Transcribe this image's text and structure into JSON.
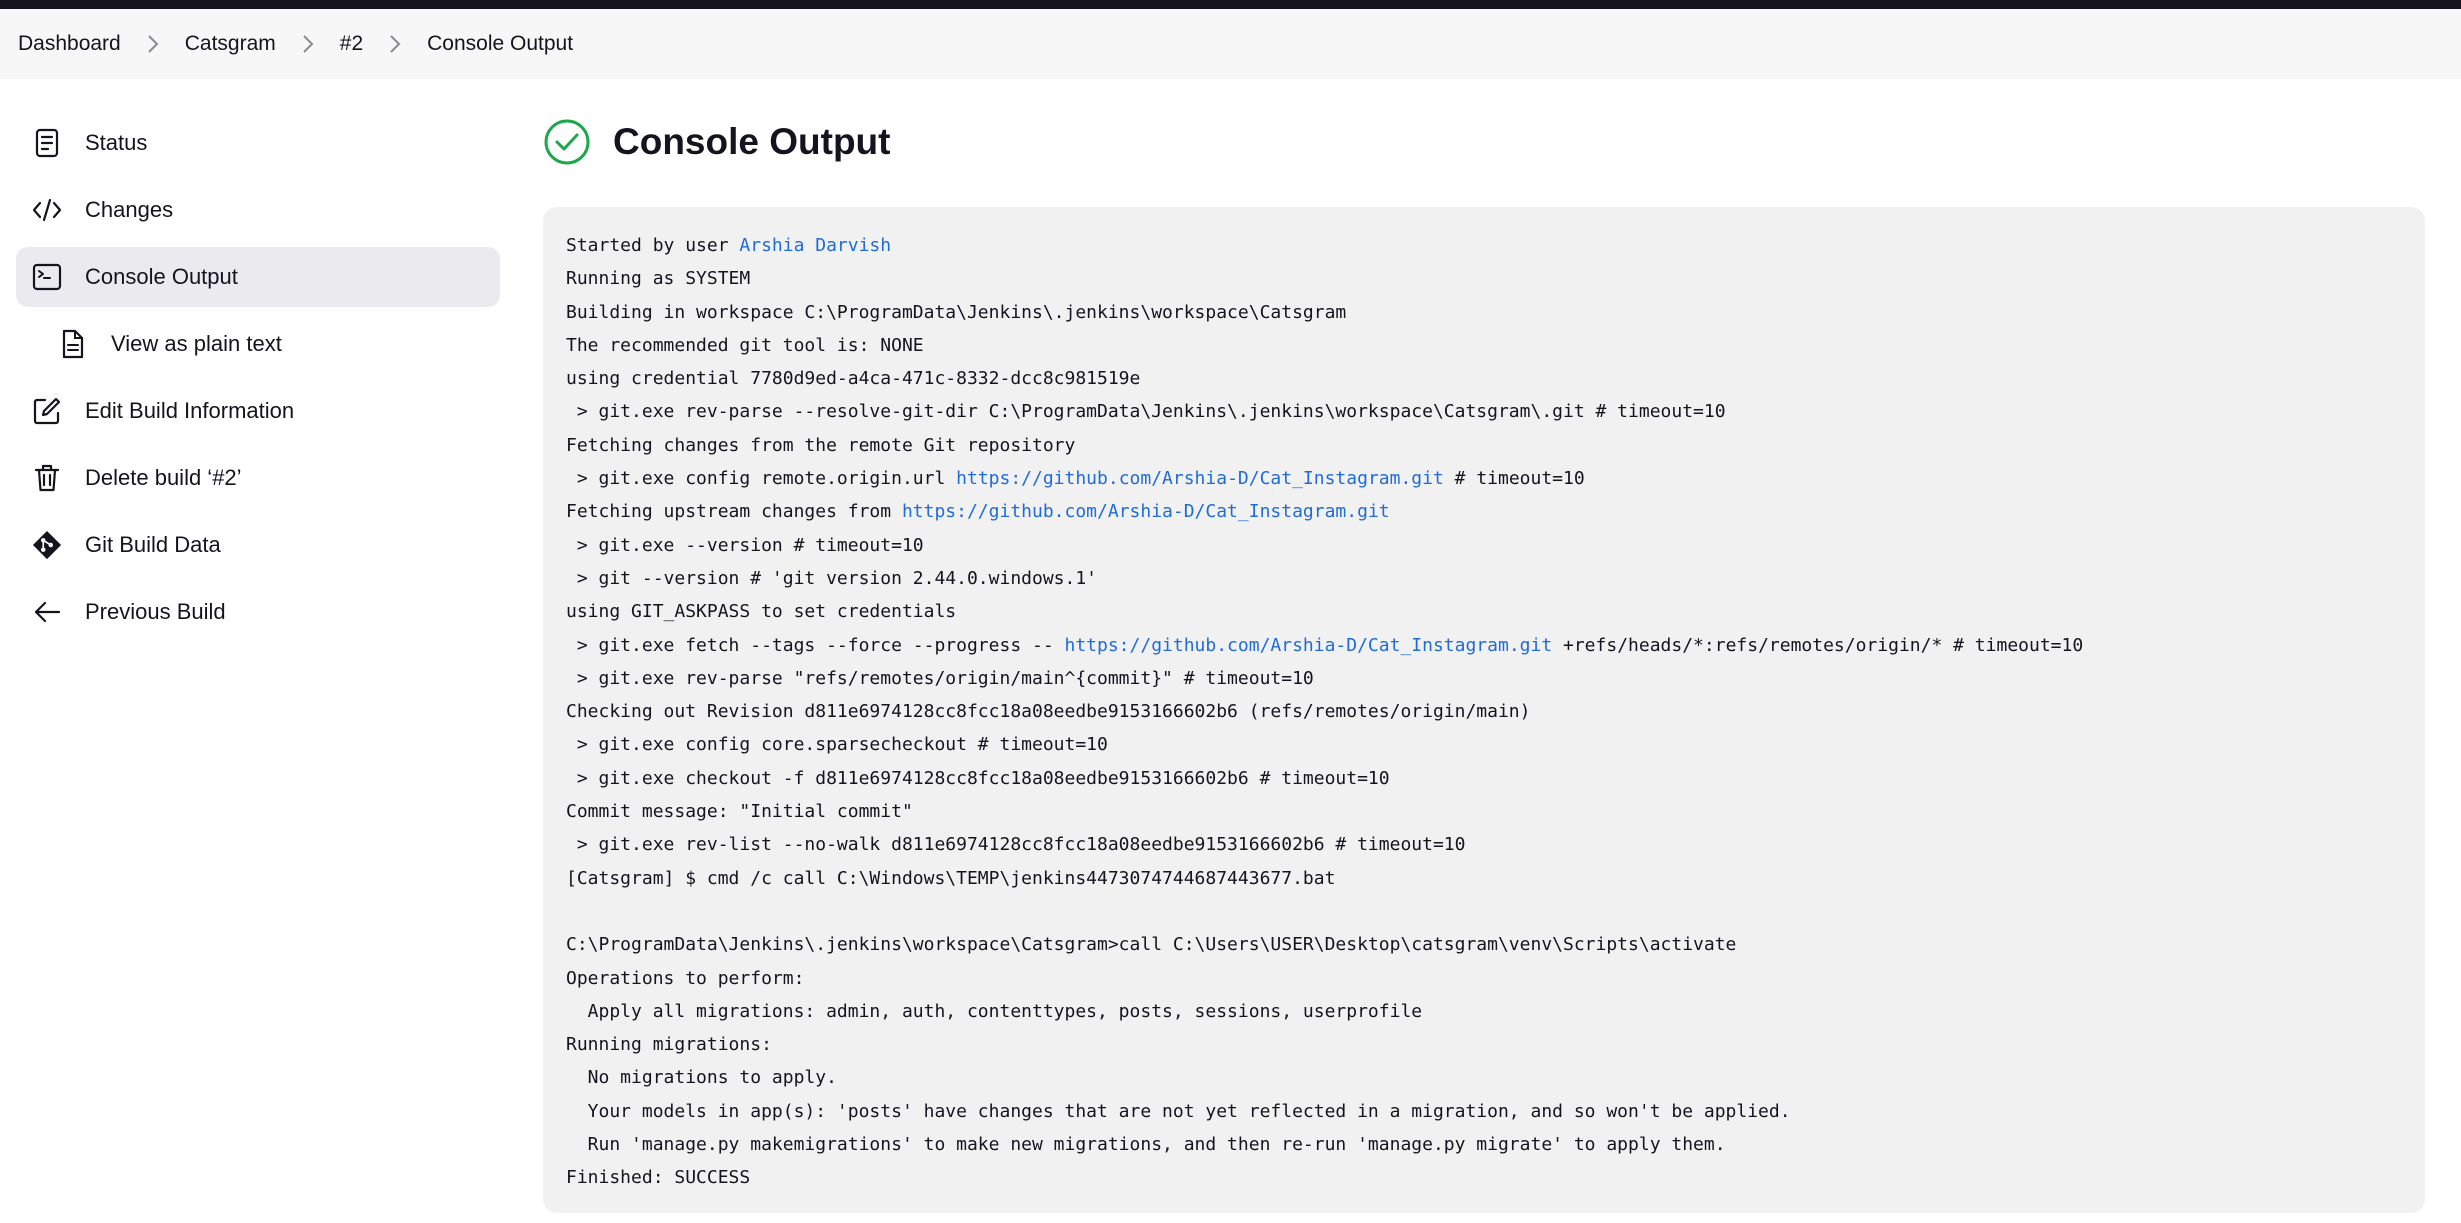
{
  "breadcrumb": [
    {
      "label": "Dashboard"
    },
    {
      "label": "Catsgram"
    },
    {
      "label": "#2"
    },
    {
      "label": "Console Output"
    }
  ],
  "sidebar": {
    "items": [
      {
        "label": "Status",
        "icon": "status-icon"
      },
      {
        "label": "Changes",
        "icon": "code-icon"
      },
      {
        "label": "Console Output",
        "icon": "terminal-icon",
        "active": true
      },
      {
        "label": "View as plain text",
        "icon": "document-icon"
      },
      {
        "label": "Edit Build Information",
        "icon": "edit-icon"
      },
      {
        "label": "Delete build ‘#2’",
        "icon": "trash-icon"
      },
      {
        "label": "Git Build Data",
        "icon": "git-icon"
      },
      {
        "label": "Previous Build",
        "icon": "arrow-left-icon"
      }
    ]
  },
  "main": {
    "title": "Console Output",
    "status_icon": "success-check-icon",
    "status_color": "#1ea64b"
  },
  "console": {
    "link_color": "#1f6bd8",
    "lines": [
      {
        "pre": "Started by user ",
        "link": "Arshia Darvish",
        "post": ""
      },
      {
        "text": "Running as SYSTEM"
      },
      {
        "text": "Building in workspace C:\\ProgramData\\Jenkins\\.jenkins\\workspace\\Catsgram"
      },
      {
        "text": "The recommended git tool is: NONE"
      },
      {
        "text": "using credential 7780d9ed-a4ca-471c-8332-dcc8c981519e"
      },
      {
        "text": " > git.exe rev-parse --resolve-git-dir C:\\ProgramData\\Jenkins\\.jenkins\\workspace\\Catsgram\\.git # timeout=10"
      },
      {
        "text": "Fetching changes from the remote Git repository"
      },
      {
        "pre": " > git.exe config remote.origin.url ",
        "link": "https://github.com/Arshia-D/Cat_Instagram.git",
        "post": " # timeout=10"
      },
      {
        "pre": "Fetching upstream changes from ",
        "link": "https://github.com/Arshia-D/Cat_Instagram.git",
        "post": ""
      },
      {
        "text": " > git.exe --version # timeout=10"
      },
      {
        "text": " > git --version # 'git version 2.44.0.windows.1'"
      },
      {
        "text": "using GIT_ASKPASS to set credentials"
      },
      {
        "pre": " > git.exe fetch --tags --force --progress -- ",
        "link": "https://github.com/Arshia-D/Cat_Instagram.git",
        "post": " +refs/heads/*:refs/remotes/origin/* # timeout=10"
      },
      {
        "text": " > git.exe rev-parse \"refs/remotes/origin/main^{commit}\" # timeout=10"
      },
      {
        "text": "Checking out Revision d811e6974128cc8fcc18a08eedbe9153166602b6 (refs/remotes/origin/main)"
      },
      {
        "text": " > git.exe config core.sparsecheckout # timeout=10"
      },
      {
        "text": " > git.exe checkout -f d811e6974128cc8fcc18a08eedbe9153166602b6 # timeout=10"
      },
      {
        "text": "Commit message: \"Initial commit\""
      },
      {
        "text": " > git.exe rev-list --no-walk d811e6974128cc8fcc18a08eedbe9153166602b6 # timeout=10"
      },
      {
        "text": "[Catsgram] $ cmd /c call C:\\Windows\\TEMP\\jenkins4473074744687443677.bat"
      },
      {
        "text": ""
      },
      {
        "text": "C:\\ProgramData\\Jenkins\\.jenkins\\workspace\\Catsgram>call C:\\Users\\USER\\Desktop\\catsgram\\venv\\Scripts\\activate"
      },
      {
        "text": "Operations to perform:"
      },
      {
        "text": "  Apply all migrations: admin, auth, contenttypes, posts, sessions, userprofile"
      },
      {
        "text": "Running migrations:"
      },
      {
        "text": "  No migrations to apply."
      },
      {
        "text": "  Your models in app(s): 'posts' have changes that are not yet reflected in a migration, and so won't be applied."
      },
      {
        "text": "  Run 'manage.py makemigrations' to make new migrations, and then re-run 'manage.py migrate' to apply them."
      },
      {
        "text": "Finished: SUCCESS"
      }
    ]
  }
}
